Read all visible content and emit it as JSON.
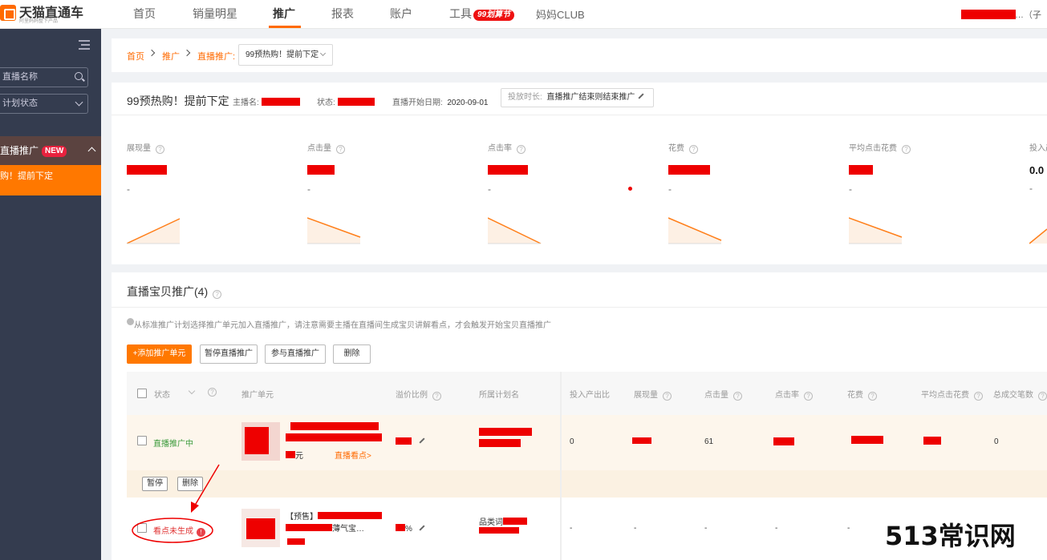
{
  "logo": {
    "title": "天猫直通车",
    "subtitle": "阿里妈妈整下产品"
  },
  "nav": {
    "items": [
      "首页",
      "销量明星",
      "推广",
      "报表",
      "账户",
      "工具",
      "妈妈CLUB"
    ],
    "active": "推广",
    "tool_badge": "99划算节",
    "account_suffix": "…（子"
  },
  "sidebar": {
    "search_placeholder": "直播名称",
    "status_select": "计划状态",
    "section_label": "直播推广",
    "section_badge": "NEW",
    "active_item": "购！提前下定"
  },
  "breadcrumb": {
    "home": "首页",
    "promo": "推广",
    "live": "直播推广:",
    "selected_plan": "99预热购！提前下定"
  },
  "plan": {
    "title": "99预热购！提前下定",
    "anchor_label": "主播名:",
    "status_label": "状态:",
    "start_label": "直播开始日期:",
    "start_date": "2020-09-01",
    "duration_label": "投放时长:",
    "duration_value": "直播推广结束则结束推广"
  },
  "metrics": [
    {
      "label": "展现量",
      "value": "",
      "trend": "-",
      "direction": "up"
    },
    {
      "label": "点击量",
      "value": "",
      "trend": "-",
      "direction": "down"
    },
    {
      "label": "点击率",
      "value": "",
      "trend": "-",
      "direction": "down"
    },
    {
      "label": "花费",
      "value": "",
      "trend": "-",
      "direction": "down"
    },
    {
      "label": "平均点击花费",
      "value": "",
      "trend": "-",
      "direction": "down"
    },
    {
      "label": "投入产出比",
      "value": "0.0",
      "trend": "-",
      "direction": "up"
    }
  ],
  "table": {
    "title": "直播宝贝推广(4)",
    "notice": "从标准推广计划选择推广单元加入直播推广，请注意需要主播在直播间生成宝贝讲解看点，才会触发开始宝贝直播推广",
    "buttons": {
      "add": "+添加推广单元",
      "pause": "暂停直播推广",
      "join": "参与直播推广",
      "delete": "删除"
    },
    "headers": [
      "状态",
      "推广单元",
      "溢价比例",
      "所属计划名",
      "投入产出比",
      "展现量",
      "点击量",
      "点击率",
      "花费",
      "平均点击花费",
      "总成交笔数"
    ],
    "rows": [
      {
        "status": "直播推广中",
        "unit_price_suffix": "元",
        "unit_link": "直播看点>",
        "roi": "0",
        "clicks": "61",
        "deals": "0",
        "action_pause": "暂停",
        "action_delete": "删除"
      },
      {
        "status": "看点未生成",
        "unit_prefix": "【预售】",
        "unit_line2": "薄气宝…",
        "plan_name": "品类词",
        "premium_suffix": "%",
        "roi": "-",
        "impressions": "-",
        "clicks": "-",
        "ctr": "-",
        "cost": "-"
      }
    ]
  },
  "watermark": "513常识网",
  "colors": {
    "accent": "#ff6a00",
    "sidebar": "#343c4f",
    "redaction": "#ee0000"
  }
}
